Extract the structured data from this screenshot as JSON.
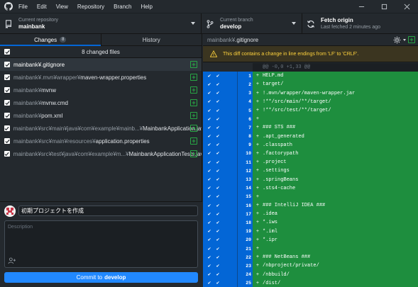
{
  "menu": {
    "file": "File",
    "edit": "Edit",
    "view": "View",
    "repository": "Repository",
    "branch": "Branch",
    "help": "Help"
  },
  "toolbar": {
    "repo_caption": "Current repository",
    "repo_name": "mainbank",
    "branch_caption": "Current branch",
    "branch_name": "develop",
    "fetch_title": "Fetch origin",
    "fetch_caption": "Last fetched 2 minutes ago"
  },
  "tabs": {
    "changes": "Changes",
    "changes_count": "8",
    "history": "History"
  },
  "changes_header": "8 changed files",
  "files": [
    {
      "dir": "",
      "name": "mainbank¥.gitignore",
      "selected": true
    },
    {
      "dir": "mainbank¥.mvn¥wrapper¥",
      "name": "maven-wrapper.properties"
    },
    {
      "dir": "mainbank¥",
      "name": "mvnw"
    },
    {
      "dir": "mainbank¥",
      "name": "mvnw.cmd"
    },
    {
      "dir": "mainbank¥",
      "name": "pom.xml"
    },
    {
      "dir": "mainbank¥src¥main¥java¥com¥example¥mainb...¥",
      "name": "MainbankApplication.java"
    },
    {
      "dir": "mainbank¥src¥main¥resources¥",
      "name": "application.properties"
    },
    {
      "dir": "mainbank¥src¥test¥java¥com¥example¥m...¥",
      "name": "MainbankApplicationTests.java"
    }
  ],
  "commit": {
    "summary": "初期プロジェクトを作成",
    "description_placeholder": "Description",
    "button_prefix": "Commit to",
    "button_branch": "develop"
  },
  "diff": {
    "path_dir": "mainbank¥",
    "path_name": ".gitignore",
    "warning": "This diff contains a change in line endings from 'LF' to 'CRLF'.",
    "hunk": "@@ -0,0 +1,33 @@",
    "lines": [
      {
        "n": "1",
        "text": "HELP.md"
      },
      {
        "n": "2",
        "text": "target/"
      },
      {
        "n": "3",
        "text": "!.mvn/wrapper/maven-wrapper.jar"
      },
      {
        "n": "4",
        "text": "!**/src/main/**/target/"
      },
      {
        "n": "5",
        "text": "!**/src/test/**/target/"
      },
      {
        "n": "6",
        "text": ""
      },
      {
        "n": "7",
        "text": "### STS ###"
      },
      {
        "n": "8",
        "text": ".apt_generated"
      },
      {
        "n": "9",
        "text": ".classpath"
      },
      {
        "n": "10",
        "text": ".factorypath"
      },
      {
        "n": "11",
        "text": ".project"
      },
      {
        "n": "12",
        "text": ".settings"
      },
      {
        "n": "13",
        "text": ".springBeans"
      },
      {
        "n": "14",
        "text": ".sts4-cache"
      },
      {
        "n": "15",
        "text": ""
      },
      {
        "n": "16",
        "text": "### IntelliJ IDEA ###"
      },
      {
        "n": "17",
        "text": ".idea"
      },
      {
        "n": "18",
        "text": "*.iws"
      },
      {
        "n": "19",
        "text": "*.iml"
      },
      {
        "n": "20",
        "text": "*.ipr"
      },
      {
        "n": "21",
        "text": ""
      },
      {
        "n": "22",
        "text": "### NetBeans ###"
      },
      {
        "n": "23",
        "text": "/nbproject/private/"
      },
      {
        "n": "24",
        "text": "/nbbuild/"
      },
      {
        "n": "25",
        "text": "/dist/"
      }
    ]
  },
  "colors": {
    "accent": "#0366d6",
    "added_bg": "#1e8e3e",
    "commit_button": "#2188ff",
    "warning_text": "#ffd33d"
  }
}
